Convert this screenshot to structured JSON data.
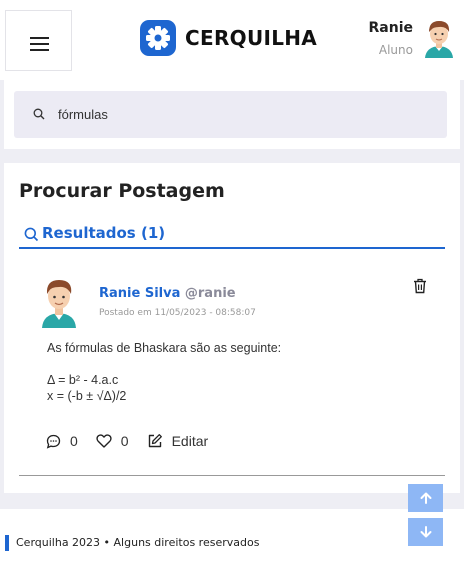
{
  "header": {
    "brand": "CERQUILHA",
    "user_name": "Ranie",
    "user_role": "Aluno"
  },
  "search": {
    "value": "fórmulas",
    "placeholder": "fórmulas"
  },
  "page": {
    "title": "Procurar Postagem",
    "results_label": "Resultados (1)"
  },
  "post": {
    "author": "Ranie Silva",
    "handle": "@ranie",
    "date": "Postado em 11/05/2023 - 08:58:07",
    "lines": [
      "As fórmulas de Bhaskara são as seguinte:",
      "Δ = b² - 4.a.c",
      "x = (-b ± √Δ)/2"
    ],
    "comments": "0",
    "likes": "0",
    "edit_label": "Editar"
  },
  "footer": {
    "text": "Cerquilha 2023 • Alguns direitos reservados"
  },
  "colors": {
    "accent": "#1e66d0",
    "scroll_button": "#8eb7f5",
    "page_bg": "#eeeef4"
  },
  "icons": [
    "menu-icon",
    "gear-logo-icon",
    "search-icon",
    "trash-icon",
    "comment-icon",
    "heart-icon",
    "edit-icon",
    "arrow-up-icon",
    "arrow-down-icon"
  ]
}
